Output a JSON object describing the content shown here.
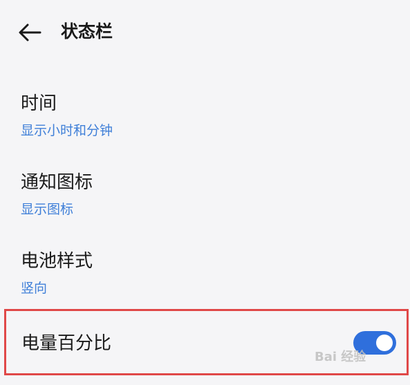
{
  "header": {
    "title": "状态栏",
    "back_icon": "arrow-left-icon"
  },
  "items": [
    {
      "title": "时间",
      "value": "显示小时和分钟"
    },
    {
      "title": "通知图标",
      "value": "显示图标"
    },
    {
      "title": "电池样式",
      "value": "竖向"
    }
  ],
  "battery_percent": {
    "title": "电量百分比",
    "toggle_on": true
  },
  "colors": {
    "accent": "#2f6fdc",
    "subtitle": "#3f7fd8",
    "highlight_border": "#e04848",
    "background": "#f5f5f7"
  },
  "watermark": "Bai 经验"
}
